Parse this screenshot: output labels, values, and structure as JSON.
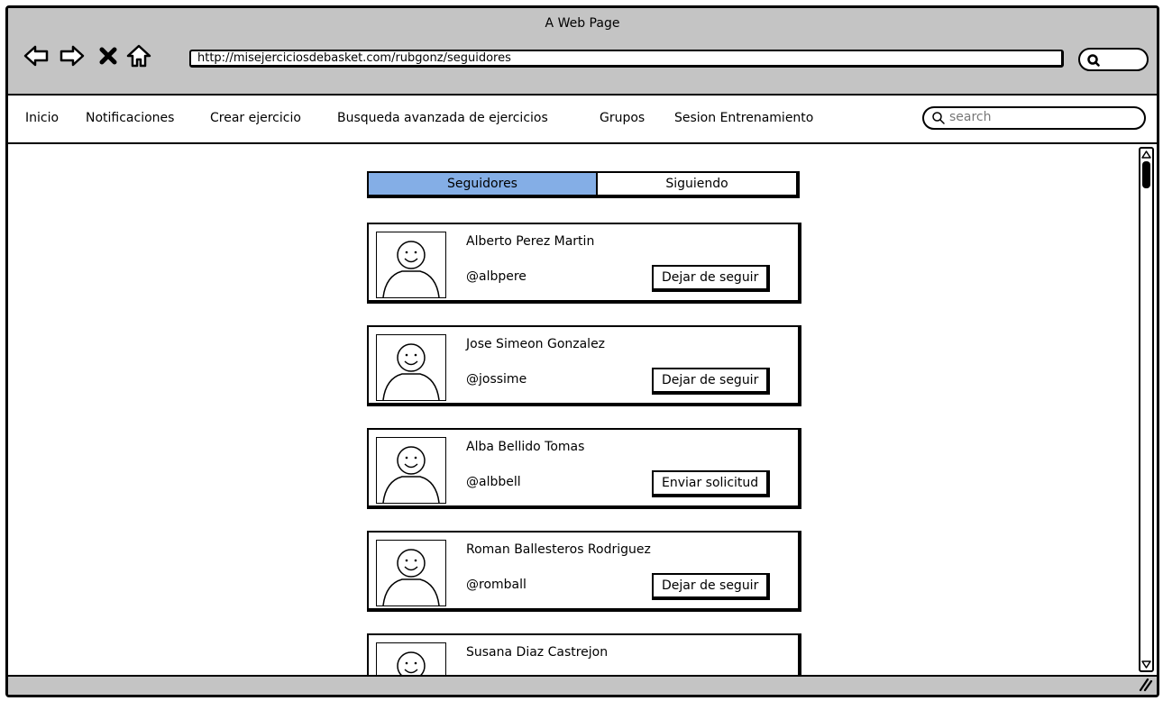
{
  "window": {
    "title": "A Web Page",
    "url": "http://misejerciciosdebasket.com/rubgonz/seguidores"
  },
  "nav": {
    "back_icon": "back-arrow",
    "forward_icon": "forward-arrow",
    "stop_icon": "close-x",
    "home_icon": "home"
  },
  "menu": {
    "items": [
      "Inicio",
      "Notificaciones",
      "Crear ejercicio",
      "Busqueda avanzada de ejercicios",
      "Grupos",
      "Sesion Entrenamiento"
    ],
    "search_placeholder": "search"
  },
  "tabs": {
    "active": "Seguidores",
    "inactive": "Siguiendo",
    "active_color": "#84aee6"
  },
  "users": [
    {
      "name": "Alberto Perez Martin",
      "handle": "@albpere",
      "action": "Dejar de seguir"
    },
    {
      "name": "Jose Simeon Gonzalez",
      "handle": "@jossime",
      "action": "Dejar de seguir"
    },
    {
      "name": "Alba Bellido Tomas",
      "handle": "@albbell",
      "action": "Enviar solicitud"
    },
    {
      "name": "Roman Ballesteros Rodriguez",
      "handle": "@romball",
      "action": "Dejar de seguir"
    },
    {
      "name": "Susana Diaz Castrejon",
      "handle": "",
      "action": ""
    }
  ]
}
